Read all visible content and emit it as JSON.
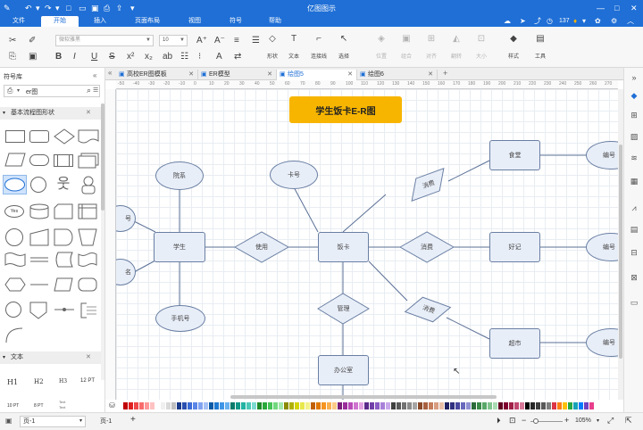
{
  "window": {
    "title": "亿图图示"
  },
  "menu": {
    "tabs": [
      "文件",
      "开始",
      "插入",
      "页面布局",
      "视图",
      "符号",
      "帮助"
    ],
    "active_index": 1,
    "user_points": "137"
  },
  "ribbon": {
    "font_family_placeholder": "微软雅黑",
    "font_size": "10",
    "tools": [
      {
        "label": "形状"
      },
      {
        "label": "文本"
      },
      {
        "label": "连接线"
      },
      {
        "label": "选择"
      }
    ],
    "arrange_tools": [
      {
        "label": "位置"
      },
      {
        "label": "组合"
      },
      {
        "label": "对齐"
      },
      {
        "label": "翻转"
      },
      {
        "label": "大小"
      }
    ],
    "style_label": "样式",
    "tools_label": "工具"
  },
  "library": {
    "title": "符号库",
    "search_value": "er图",
    "section_basic": "基本流程图形状",
    "section_text": "文本",
    "yes_label": "Yes",
    "text_samples": [
      "H1",
      "H2",
      "H3",
      "12 PT",
      "10 PT",
      "8 PT",
      "Text",
      "Text"
    ]
  },
  "doc_tabs": [
    {
      "label": "高校ER图模板",
      "active": false
    },
    {
      "label": "ER模型",
      "active": false
    },
    {
      "label": "绘图5",
      "active": true
    },
    {
      "label": "绘图6",
      "active": false
    }
  ],
  "ruler_ticks": [
    "-50",
    "-40",
    "-30",
    "-20",
    "-10",
    "0",
    "10",
    "20",
    "30",
    "40",
    "50",
    "60",
    "70",
    "80",
    "90",
    "100",
    "110",
    "120",
    "130",
    "140",
    "150",
    "160",
    "170",
    "180",
    "190",
    "200",
    "210",
    "220",
    "230",
    "240",
    "250",
    "260",
    "270"
  ],
  "diagram": {
    "title": "学生饭卡E-R图",
    "entities": {
      "student": "学生",
      "card": "饭卡",
      "canteen": "食堂",
      "haoji": "好记",
      "supermarket": "超市",
      "office": "办公室"
    },
    "relations": {
      "use": "使用",
      "consume1": "消费",
      "consume2": "消费",
      "consume3": "消费",
      "manage": "管理"
    },
    "attributes": {
      "college": "院系",
      "card_no": "卡号",
      "phone": "手机号",
      "left_top_partial": "号",
      "left_bottom_partial": "名",
      "no1": "编号",
      "no2": "编号",
      "no3": "编号"
    }
  },
  "colors": {
    "brand": "#1f6fd6",
    "node_fill": "#e8eef8",
    "node_border": "#6a7fa3",
    "title_chip": "#f7b500"
  },
  "status": {
    "page_selector": "页-1",
    "page_tab": "页-1",
    "add_page": "+",
    "zoom": "105%"
  }
}
